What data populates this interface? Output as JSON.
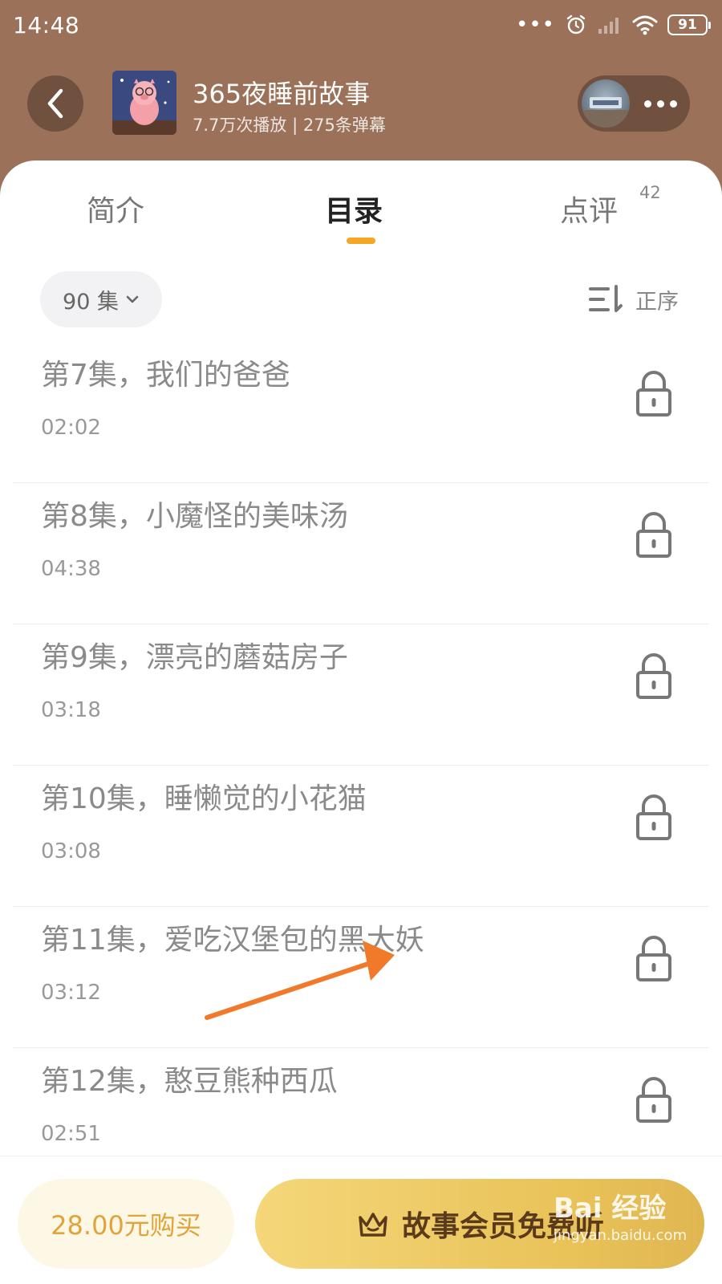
{
  "status_bar": {
    "time": "14:48",
    "battery": "91",
    "icons": [
      "more-dots-icon",
      "alarm-icon",
      "signal-icon",
      "wifi-icon",
      "battery-icon"
    ]
  },
  "header": {
    "back_icon": "chevron-left-icon",
    "title": "365夜睡前故事",
    "meta": "7.7万次播放 | 275条弹幕",
    "more_icon": "more-horizontal-icon"
  },
  "tabs": [
    {
      "label": "简介"
    },
    {
      "label": "目录",
      "active": true
    },
    {
      "label": "点评",
      "badge": "42"
    }
  ],
  "colors": {
    "header_bg": "#9b7259",
    "accent": "#f5a623",
    "vip_gradient_start": "#f4d77a",
    "vip_gradient_end": "#e0b651",
    "buy_text": "#e0a43a"
  },
  "filter": {
    "label": "90 集",
    "icon": "chevron-down-icon"
  },
  "sort": {
    "label": "正序",
    "icon": "sort-icon"
  },
  "episodes": [
    {
      "title": "第7集，我们的爸爸",
      "duration": "02:02",
      "locked": true
    },
    {
      "title": "第8集，小魔怪的美味汤",
      "duration": "04:38",
      "locked": true
    },
    {
      "title": "第9集，漂亮的蘑菇房子",
      "duration": "03:18",
      "locked": true
    },
    {
      "title": "第10集，睡懒觉的小花猫",
      "duration": "03:08",
      "locked": true
    },
    {
      "title": "第11集，爱吃汉堡包的黑大妖",
      "duration": "03:12",
      "locked": true
    },
    {
      "title": "第12集，憨豆熊种西瓜",
      "duration": "02:51",
      "locked": true
    }
  ],
  "bottom": {
    "buy_label": "28.00元购买",
    "vip_label": "故事会员免费听",
    "vip_icon": "crown-icon"
  },
  "watermark": {
    "brand": "Bai 经验",
    "url": "jingyan.baidu.com"
  }
}
